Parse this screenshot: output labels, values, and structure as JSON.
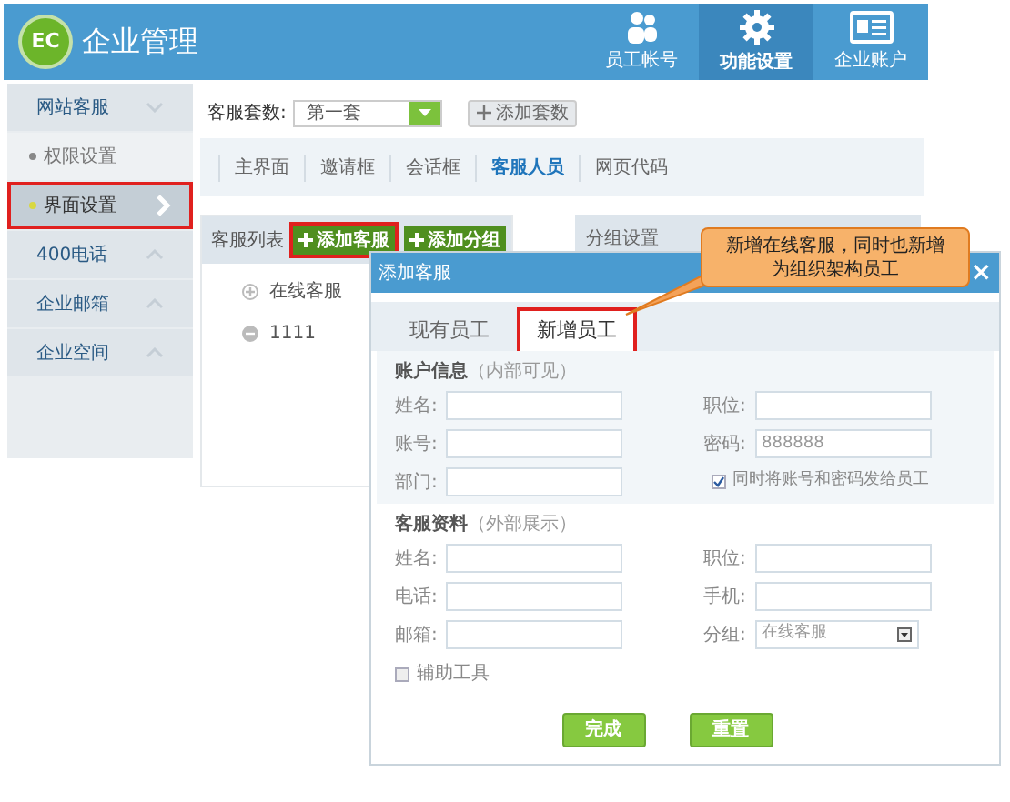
{
  "header": {
    "logo_text": "EC",
    "title": "企业管理",
    "nav": [
      {
        "label": "员工帐号",
        "selected": false
      },
      {
        "label": "功能设置",
        "selected": true
      },
      {
        "label": "企业账户",
        "selected": false
      }
    ]
  },
  "sidebar": {
    "groups": [
      {
        "label": "网站客服",
        "expanded": true,
        "children": [
          {
            "label": "权限设置",
            "selected": false,
            "highlighted": false
          },
          {
            "label": "界面设置",
            "selected": true,
            "highlighted": true
          }
        ]
      },
      {
        "label": "400电话",
        "expanded": false
      },
      {
        "label": "企业邮箱",
        "expanded": false
      },
      {
        "label": "企业空间",
        "expanded": false
      }
    ]
  },
  "set_row": {
    "label": "客服套数:",
    "select_value": "第一套",
    "add_button": "添加套数"
  },
  "tabs": [
    {
      "label": "主界面",
      "selected": false
    },
    {
      "label": "邀请框",
      "selected": false
    },
    {
      "label": "会话框",
      "selected": false
    },
    {
      "label": "客服人员",
      "selected": true
    },
    {
      "label": "网页代码",
      "selected": false
    }
  ],
  "list_panel": {
    "title": "客服列表",
    "buttons": [
      {
        "label": "添加客服",
        "highlighted": true
      },
      {
        "label": "添加分组",
        "highlighted": false
      }
    ],
    "tree": [
      {
        "label": "在线客服",
        "expanded": false
      },
      {
        "label": "1111",
        "expanded": true
      }
    ]
  },
  "group_panel": {
    "title": "分组设置"
  },
  "dialog": {
    "title": "添加客服",
    "close": "×",
    "tabs": [
      {
        "label": "现有员工",
        "selected": false,
        "highlighted": false
      },
      {
        "label": "新增员工",
        "selected": true,
        "highlighted": true
      }
    ],
    "sections": [
      {
        "title": "账户信息",
        "note": "（内部可见）",
        "shaded": true,
        "fields": [
          {
            "label": "姓名:",
            "kind": "input"
          },
          {
            "label": "职位:",
            "kind": "input"
          },
          {
            "label": "账号:",
            "kind": "input"
          },
          {
            "label": "密码:",
            "kind": "input",
            "value": "888888"
          },
          {
            "label": "部门:",
            "kind": "input"
          },
          {
            "kind": "checkbox",
            "label": "同时将账号和密码发给员工",
            "checked": true
          }
        ]
      },
      {
        "title": "客服资料",
        "note": "（外部展示）",
        "shaded": false,
        "fields": [
          {
            "label": "姓名:",
            "kind": "input"
          },
          {
            "label": "职位:",
            "kind": "input"
          },
          {
            "label": "电话:",
            "kind": "input"
          },
          {
            "label": "手机:",
            "kind": "input"
          },
          {
            "label": "邮箱:",
            "kind": "input"
          },
          {
            "label": "分组:",
            "kind": "select",
            "value": "在线客服"
          }
        ]
      }
    ],
    "extra_checkbox": {
      "label": "辅助工具",
      "checked": false
    },
    "buttons": [
      "完成",
      "重置"
    ]
  },
  "callout": {
    "lines": [
      "新增在线客服，同时也新增",
      "为组织架构员工"
    ]
  }
}
